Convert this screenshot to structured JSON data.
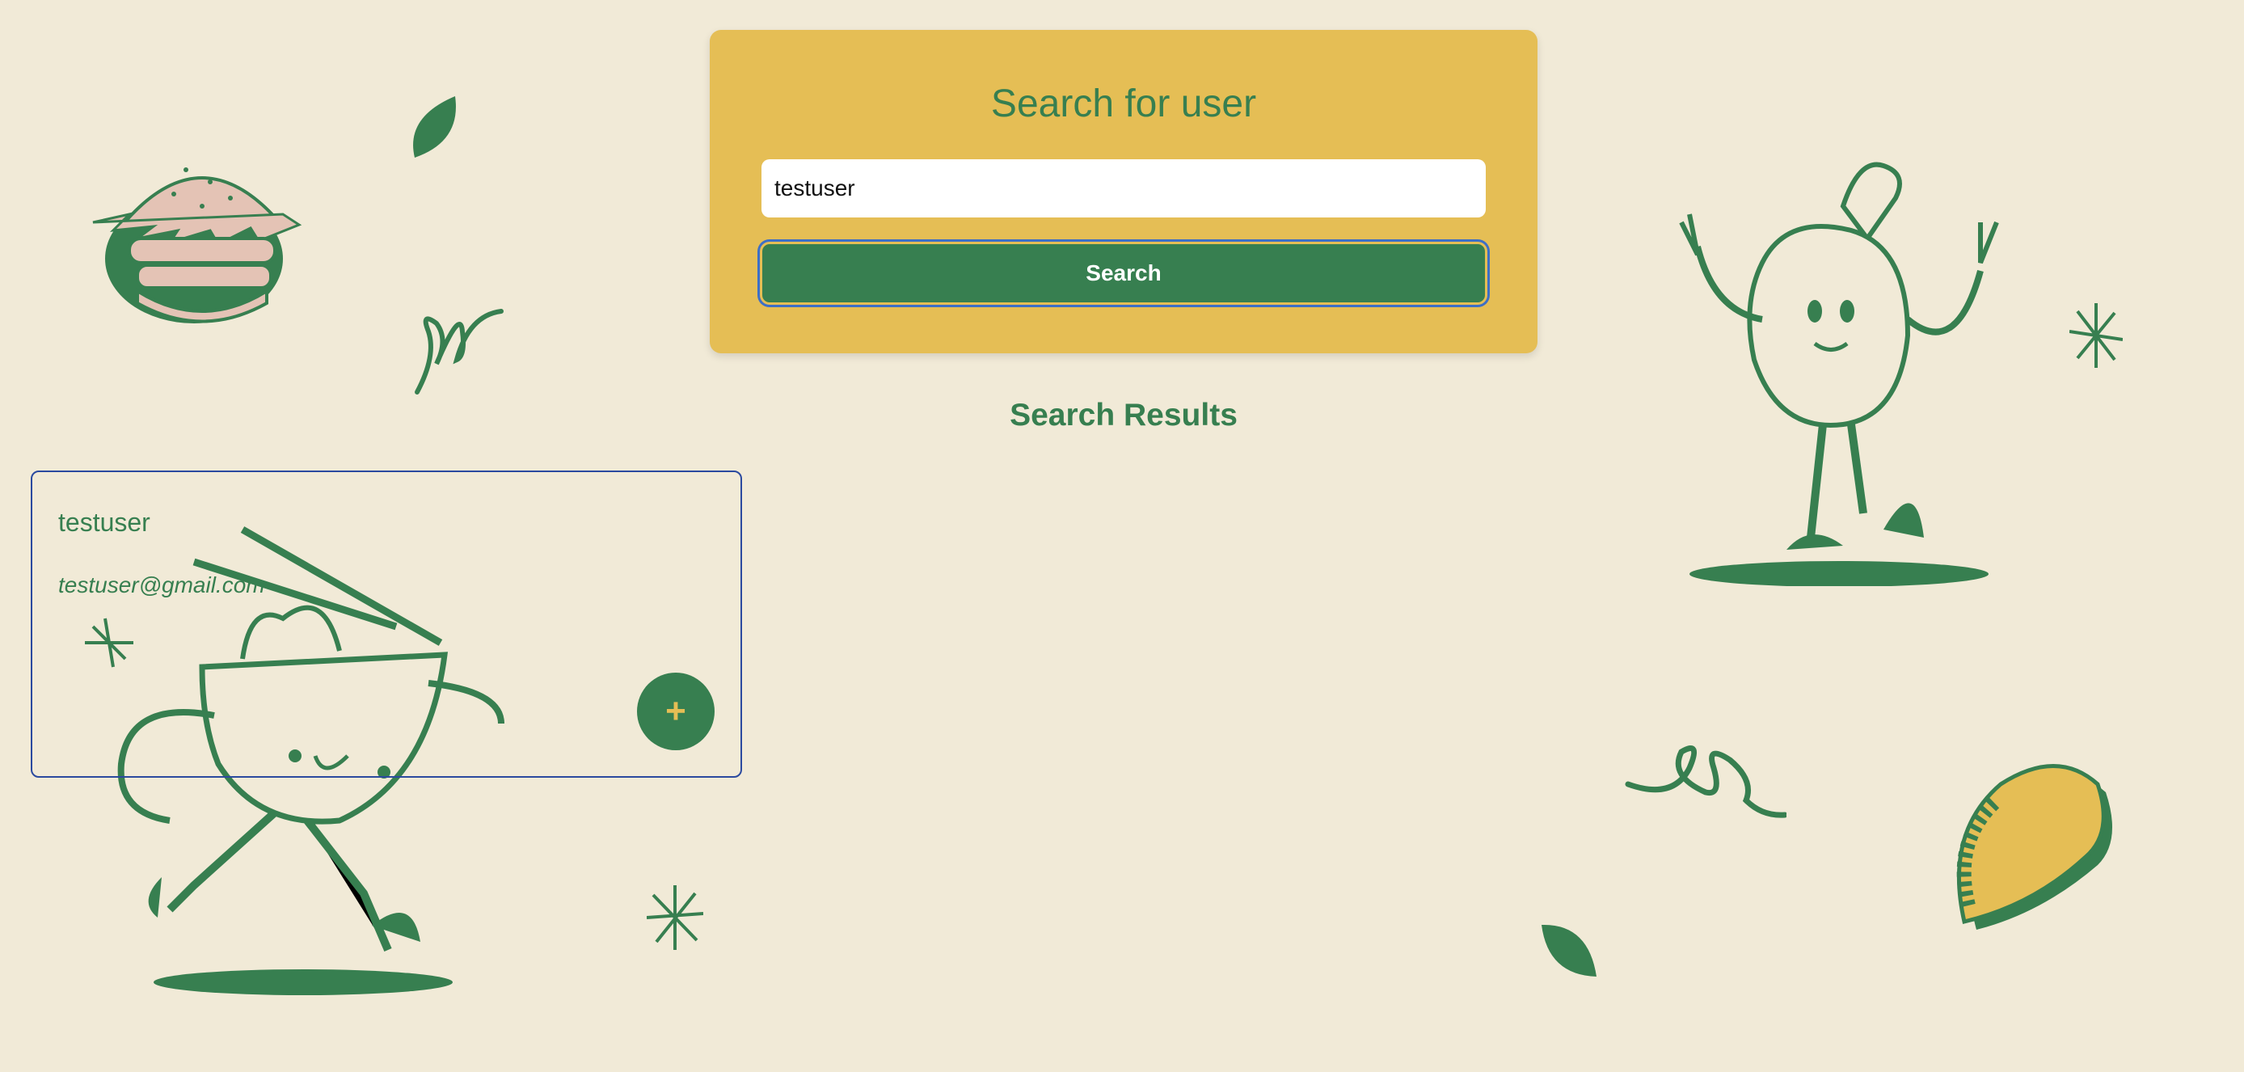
{
  "search": {
    "title": "Search for user",
    "input_value": "testuser",
    "button_label": "Search"
  },
  "results": {
    "title": "Search Results",
    "items": [
      {
        "username": "testuser",
        "email": "testuser@gmail.com",
        "add_label": "+"
      }
    ]
  },
  "colors": {
    "background": "#f1ead7",
    "card": "#e5be55",
    "green": "#377f50",
    "focus": "#3d6fc6"
  },
  "decorations": [
    "burger-illustration",
    "chicken-leg-illustration",
    "noodle-bowl-illustration",
    "taco-illustration",
    "leaf-icon",
    "squiggle-icon",
    "sparkle-icon"
  ]
}
